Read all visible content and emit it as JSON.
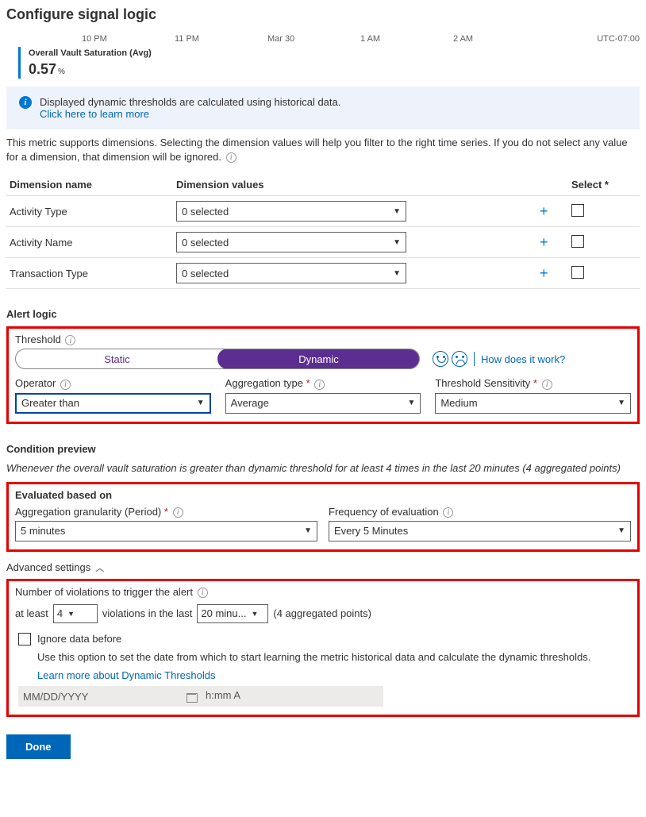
{
  "title": "Configure signal logic",
  "timeAxis": {
    "t1": "10 PM",
    "t2": "11 PM",
    "t3": "Mar 30",
    "t4": "1 AM",
    "t5": "2 AM",
    "tz": "UTC-07:00"
  },
  "metric": {
    "name": "Overall Vault Saturation (Avg)",
    "value": "0.57",
    "unit": "%"
  },
  "infoCallout": {
    "line1": "Displayed dynamic thresholds are calculated using historical data.",
    "link": "Click here to learn more"
  },
  "dimHelp": "This metric supports dimensions. Selecting the dimension values will help you filter to the right time series. If you do not select any value for a dimension, that dimension will be ignored.",
  "dimTable": {
    "headers": {
      "name": "Dimension name",
      "values": "Dimension values",
      "select": "Select *"
    },
    "rows": [
      {
        "name": "Activity Type",
        "value": "0 selected"
      },
      {
        "name": "Activity Name",
        "value": "0 selected"
      },
      {
        "name": "Transaction Type",
        "value": "0 selected"
      }
    ]
  },
  "alertLogic": {
    "heading": "Alert logic",
    "thresholdLabel": "Threshold",
    "toggle": {
      "static": "Static",
      "dynamic": "Dynamic"
    },
    "howLink": "How does it work?",
    "operator": {
      "label": "Operator",
      "value": "Greater than"
    },
    "aggType": {
      "label": "Aggregation type",
      "value": "Average"
    },
    "sensitivity": {
      "label": "Threshold Sensitivity",
      "value": "Medium"
    }
  },
  "preview": {
    "heading": "Condition preview",
    "text": "Whenever the overall vault saturation is greater than dynamic threshold for at least 4 times in the last 20 minutes (4 aggregated points)"
  },
  "eval": {
    "heading": "Evaluated based on",
    "gran": {
      "label": "Aggregation granularity (Period)",
      "value": "5 minutes"
    },
    "freq": {
      "label": "Frequency of evaluation",
      "value": "Every 5 Minutes"
    }
  },
  "advanced": {
    "toggleLabel": "Advanced settings",
    "violationsLabel": "Number of violations to trigger the alert",
    "atLeast": "at least",
    "violCount": "4",
    "inLast": "violations in the last",
    "window": "20 minu...",
    "aggNote": "(4 aggregated points)",
    "ignore": {
      "label": "Ignore data before",
      "desc": "Use this option to set the date from which to start learning the metric historical data and calculate the dynamic thresholds.",
      "learnLink": "Learn more about Dynamic Thresholds",
      "datePlaceholder": "MM/DD/YYYY",
      "timePlaceholder": "h:mm A"
    }
  },
  "doneLabel": "Done"
}
